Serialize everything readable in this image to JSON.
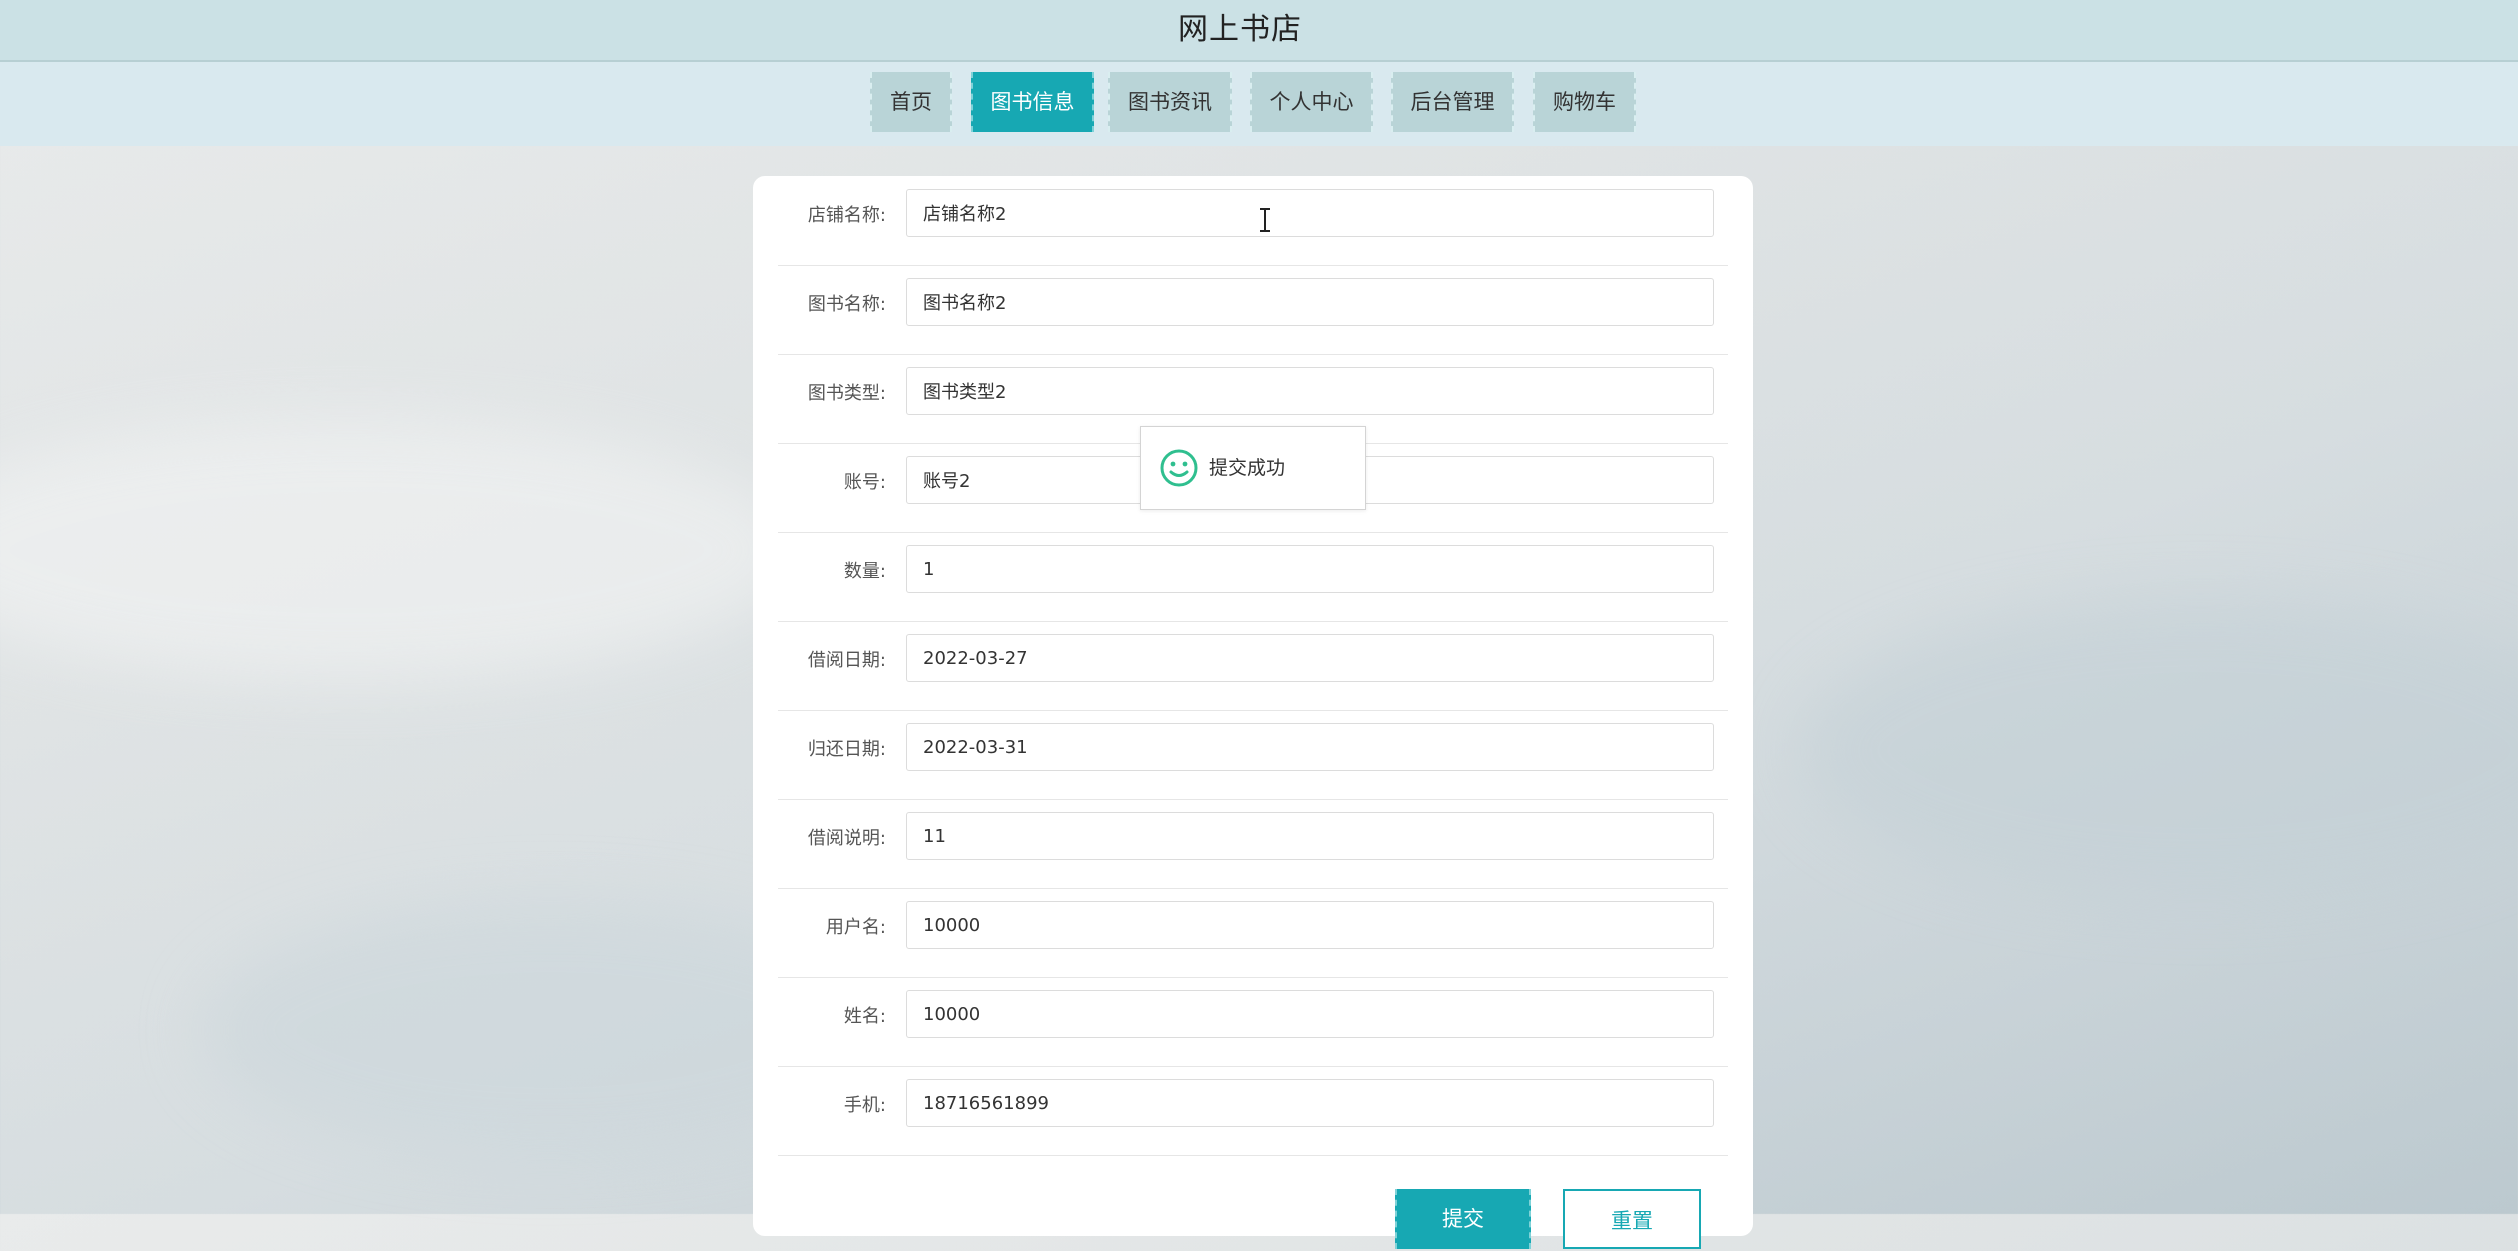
{
  "site": {
    "title": "网上书店"
  },
  "nav": {
    "items": [
      {
        "label": "首页"
      },
      {
        "label": "图书信息"
      },
      {
        "label": "图书资讯"
      },
      {
        "label": "个人中心"
      },
      {
        "label": "后台管理"
      },
      {
        "label": "购物车"
      }
    ],
    "active_index": 1,
    "active_color": "#17a8b3"
  },
  "form": {
    "fields": [
      {
        "label": "店铺名称:",
        "value": "店铺名称2"
      },
      {
        "label": "图书名称:",
        "value": "图书名称2"
      },
      {
        "label": "图书类型:",
        "value": "图书类型2"
      },
      {
        "label": "账号:",
        "value": "账号2"
      },
      {
        "label": "数量:",
        "value": "1"
      },
      {
        "label": "借阅日期:",
        "value": "2022-03-27"
      },
      {
        "label": "归还日期:",
        "value": "2022-03-31"
      },
      {
        "label": "借阅说明:",
        "value": "11"
      },
      {
        "label": "用户名:",
        "value": "10000"
      },
      {
        "label": "姓名:",
        "value": "10000"
      },
      {
        "label": "手机:",
        "value": "18716561899"
      }
    ],
    "submit_label": "提交",
    "reset_label": "重置"
  },
  "toast": {
    "message": "提交成功",
    "icon": "smile-icon",
    "icon_color": "#2fbf8f"
  }
}
